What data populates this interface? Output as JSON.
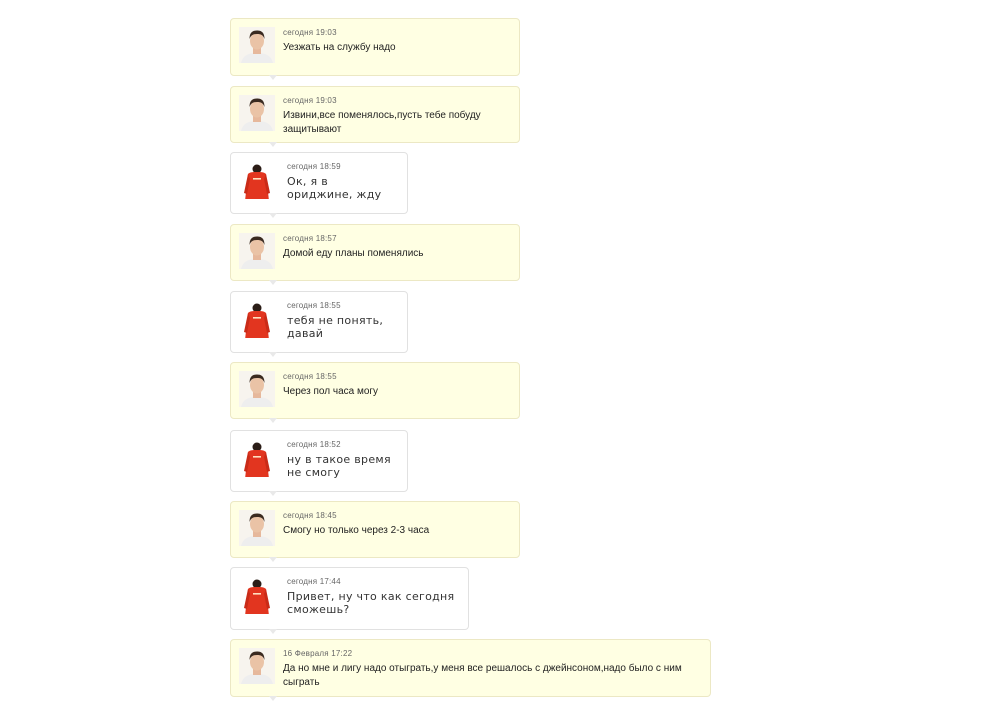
{
  "messages": [
    {
      "sender": "male",
      "time": "сегодня 19:03",
      "text": "Уезжать на службу надо"
    },
    {
      "sender": "male",
      "time": "сегодня 19:03",
      "text": "Извини,все поменялось,пусть тебе побуду защитывают"
    },
    {
      "sender": "red",
      "time": "сегодня 18:59",
      "text": "Ок, я в ориджине, жду"
    },
    {
      "sender": "male",
      "time": "сегодня 18:57",
      "text": "Домой еду планы поменялись"
    },
    {
      "sender": "red",
      "time": "сегодня 18:55",
      "text": "тебя не понять, давай"
    },
    {
      "sender": "male",
      "time": "сегодня 18:55",
      "text": "Через пол часа могу"
    },
    {
      "sender": "red",
      "time": "сегодня 18:52",
      "text": "ну в такое время не смогу"
    },
    {
      "sender": "male",
      "time": "сегодня 18:45",
      "text": "Смогу но только через 2-3 часа"
    },
    {
      "sender": "red",
      "time": "сегодня 17:44",
      "text": "Привет, ну что как сегодня сможешь?"
    },
    {
      "sender": "male",
      "time": "16 Февраля 17:22",
      "text": "Да но мне и лигу надо отыграть,у меня все решалось с джейнсоном,надо было с ним сыграть"
    }
  ],
  "avatars": {
    "male": {
      "icon": "male-avatar-icon"
    },
    "red": {
      "icon": "red-hoodie-avatar-icon"
    }
  },
  "colors": {
    "bubble_incoming": "#ffffe3",
    "bubble_outgoing": "#ffffff",
    "hoodie": "#e2351f"
  }
}
